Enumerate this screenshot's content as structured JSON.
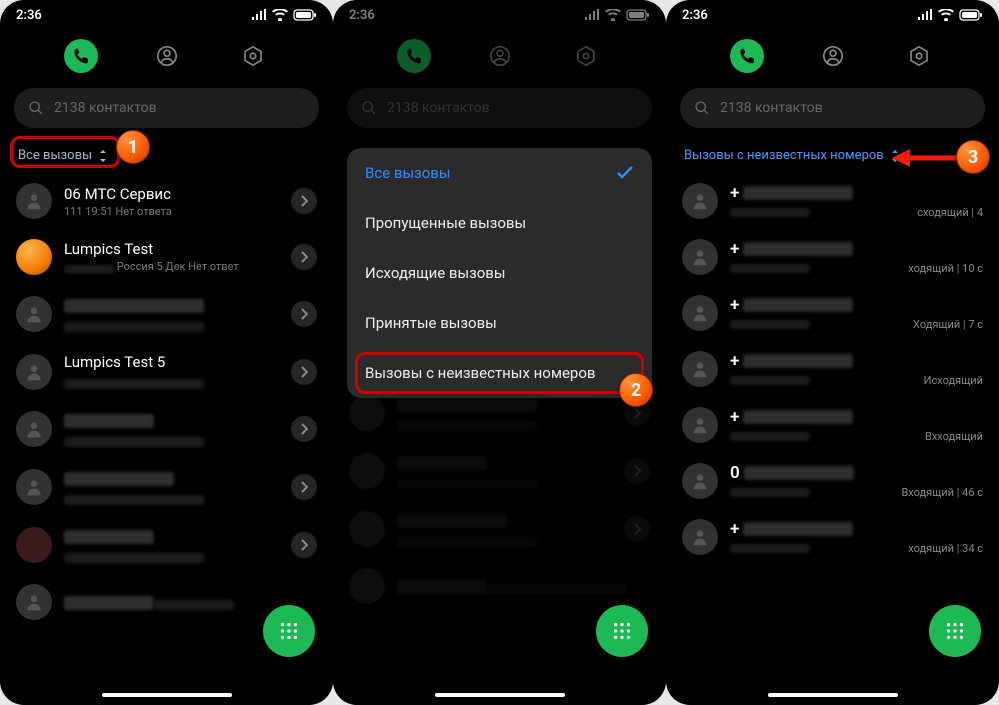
{
  "status": {
    "time": "2:36"
  },
  "search": {
    "placeholder": "2138 контактов"
  },
  "panel1": {
    "filter_label": "Все вызовы",
    "items": [
      {
        "name": "06 МТС Сервис",
        "sub": "111 19:51 Нет ответа"
      },
      {
        "name": "Lumpics Test",
        "sub": "Россия  5 Дек Нет ответ",
        "orange": true
      },
      {
        "name": "",
        "sub": ""
      },
      {
        "name": "Lumpics Test 5",
        "sub": ""
      },
      {
        "name": "",
        "sub": ""
      },
      {
        "name": "",
        "sub": ""
      },
      {
        "name": "",
        "sub": ""
      },
      {
        "name": "",
        "sub": ""
      }
    ]
  },
  "panel2": {
    "menu": [
      "Все вызовы",
      "Пропущенные вызовы",
      "Исходящие вызовы",
      "Принятые вызовы",
      "Вызовы с неизвестных номеров"
    ]
  },
  "panel3": {
    "filter_label": "Вызовы с неизвестных номеров",
    "tails": [
      "cходящий | 4",
      "ходящий | 10 c",
      "Ходящий | 7 c",
      "Исходящий",
      "Вхходящий",
      "Входящий | 46 c",
      "ходящий | 34 c"
    ]
  },
  "bubbles": {
    "b1": "1",
    "b2": "2",
    "b3": "3"
  }
}
